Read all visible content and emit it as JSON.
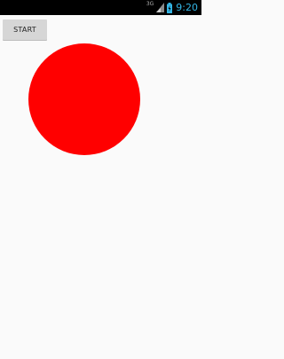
{
  "status_bar": {
    "network_type": "3G",
    "time": "9:20",
    "accent_color": "#33b5e5",
    "icons": [
      "signal-icon",
      "battery-icon"
    ]
  },
  "controls": {
    "start_label": "START"
  },
  "canvas": {
    "shape": "circle",
    "fill_color": "#ff0000",
    "background_color": "#fafafa"
  }
}
